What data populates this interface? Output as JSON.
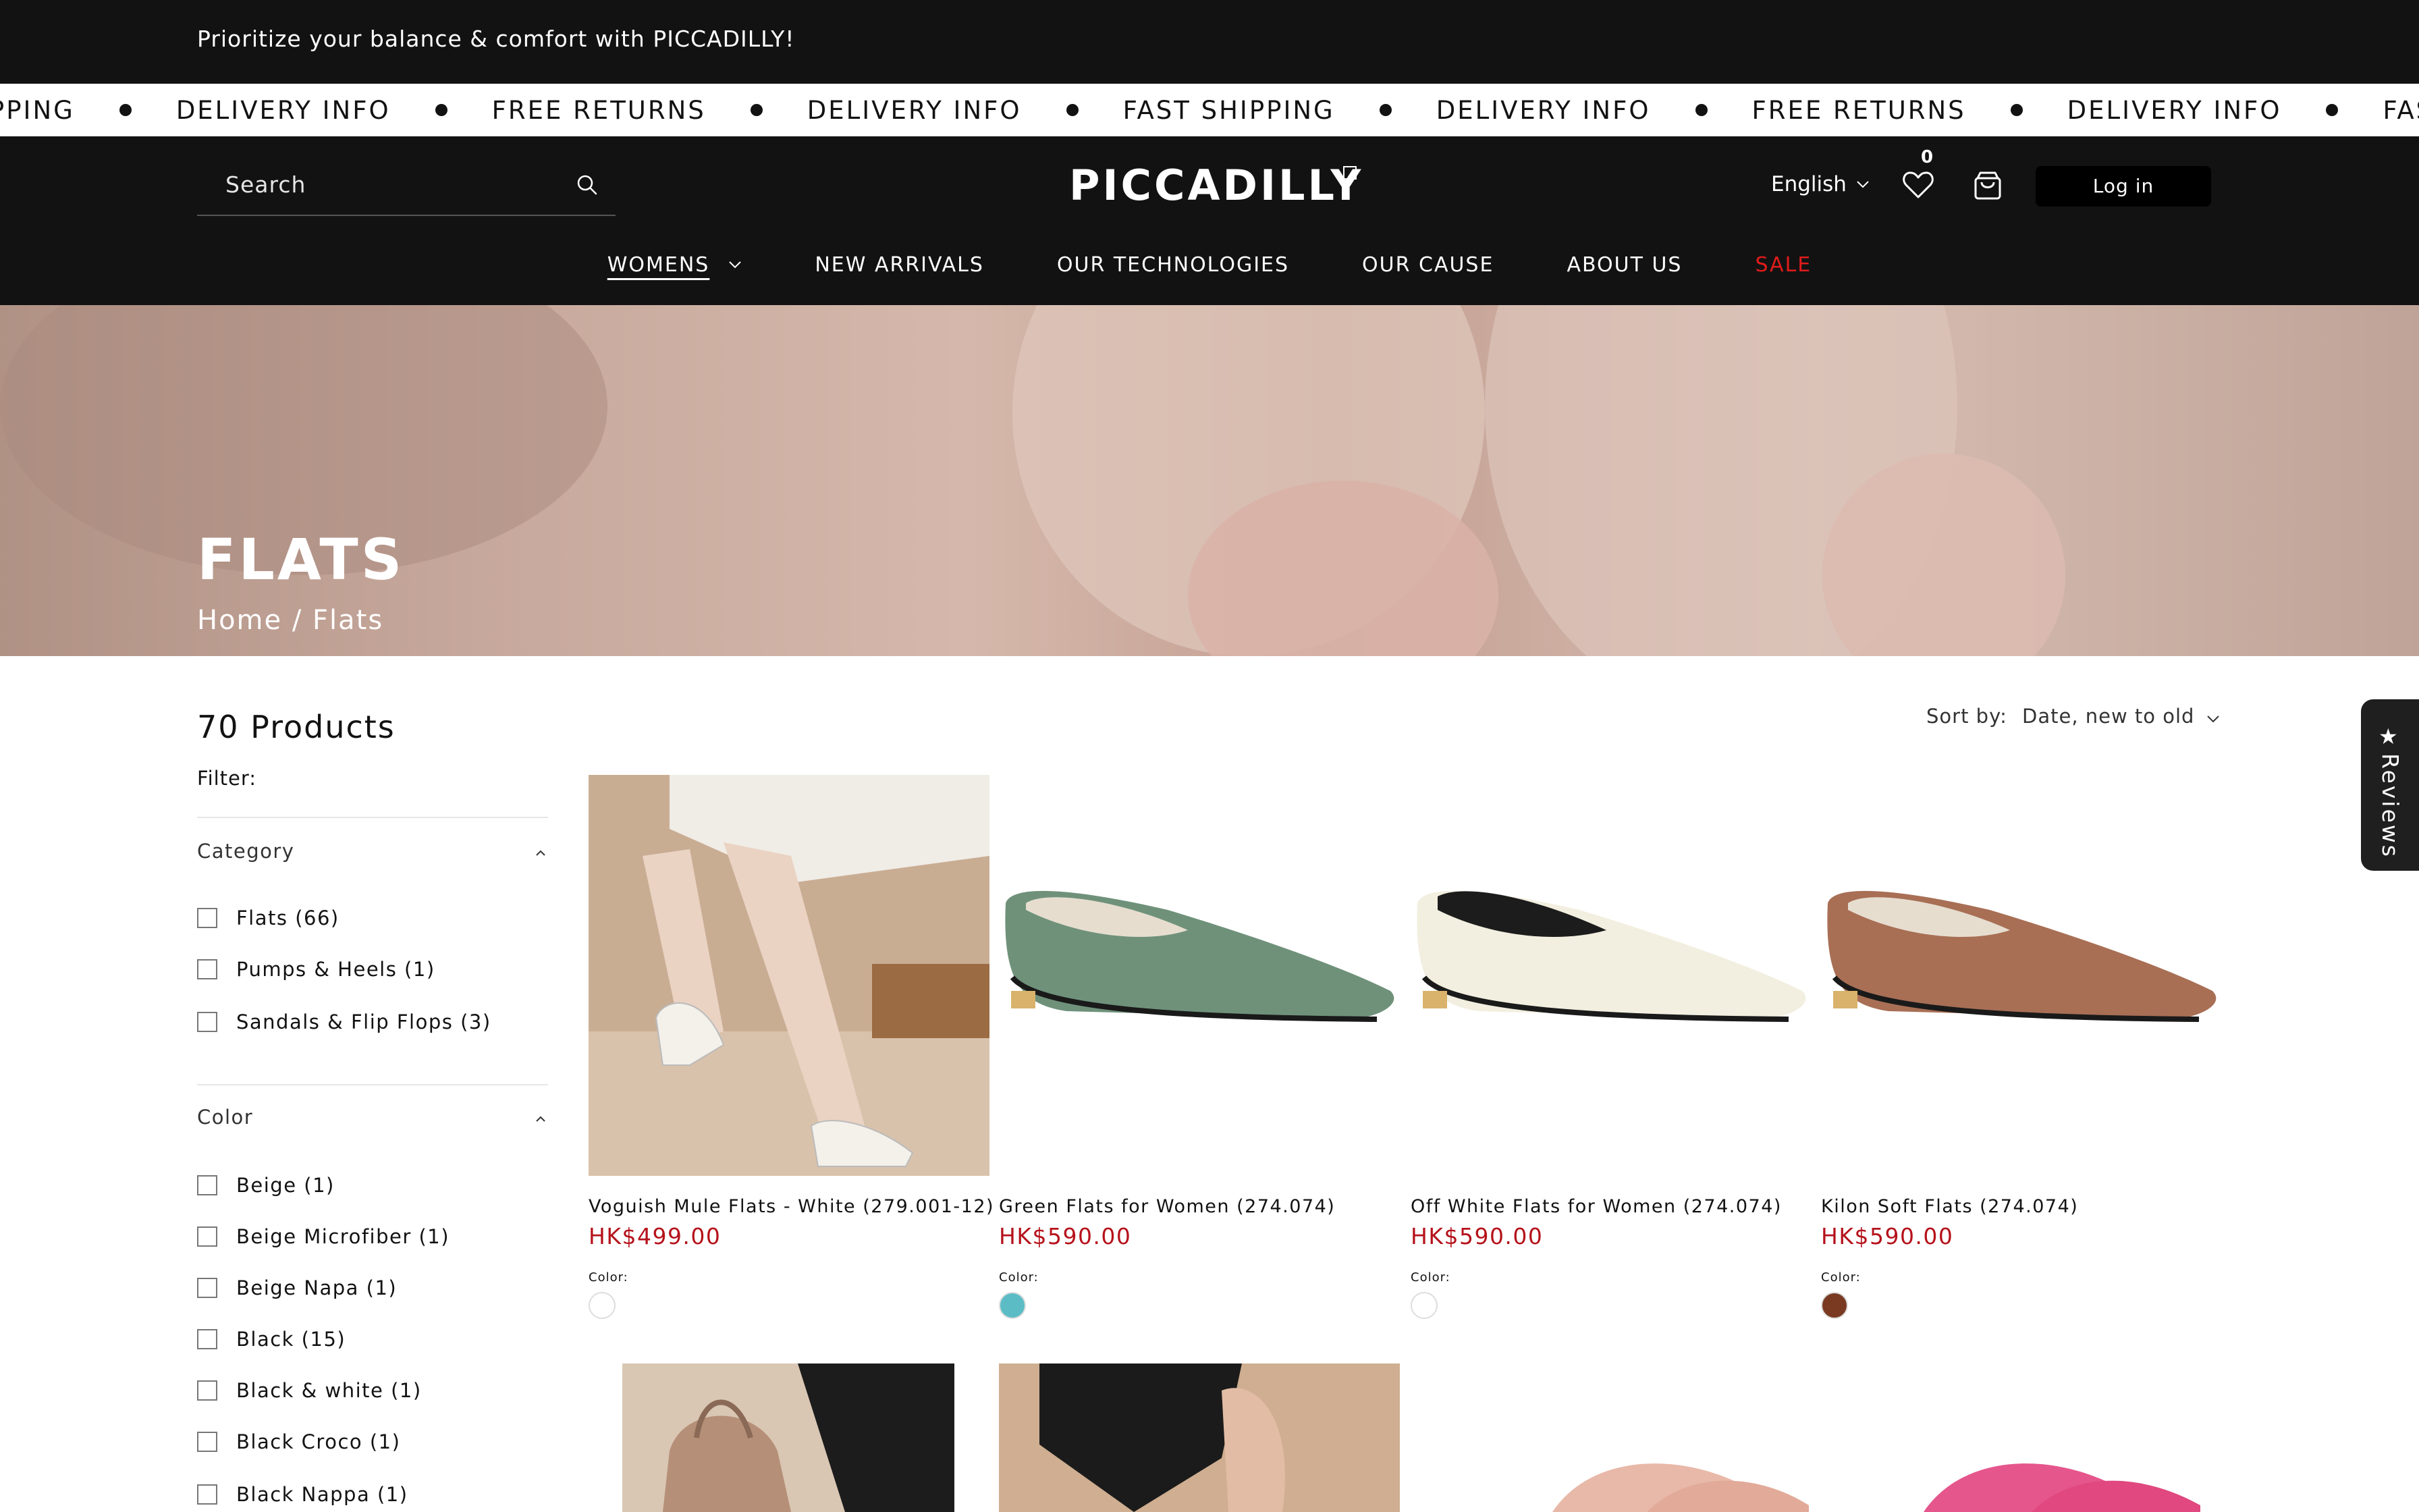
{
  "announcement": {
    "text": "Prioritize your balance & comfort with PICCADILLY!"
  },
  "marquee": {
    "items": [
      "IPPING",
      "DELIVERY INFO",
      "FREE RETURNS",
      "DELIVERY INFO",
      "FAST SHIPPING",
      "DELIVERY INFO",
      "FREE RETURNS",
      "DELIVERY INFO",
      "FAST SHIPPING"
    ]
  },
  "header": {
    "search_placeholder": "Search",
    "logo": "PICCADILLY",
    "language": "English",
    "wishlist_count": "0",
    "login_label": "Log in"
  },
  "nav": {
    "items": [
      {
        "label": "WOMENS"
      },
      {
        "label": "NEW ARRIVALS"
      },
      {
        "label": "OUR TECHNOLOGIES"
      },
      {
        "label": "OUR CAUSE"
      },
      {
        "label": "ABOUT US"
      },
      {
        "label": "SALE"
      }
    ]
  },
  "banner": {
    "title": "FLATS",
    "breadcrumb": "Home / Flats"
  },
  "listing": {
    "product_count": "70 Products",
    "filter_label": "Filter:",
    "sort_label": "Sort by:",
    "sort_value": "Date, new to old"
  },
  "filters": {
    "category": {
      "title": "Category",
      "options": [
        "Flats (66)",
        "Pumps & Heels (1)",
        "Sandals & Flip Flops (3)"
      ]
    },
    "color": {
      "title": "Color",
      "options": [
        "Beige (1)",
        "Beige Microfiber (1)",
        "Beige Napa (1)",
        "Black (15)",
        "Black & white (1)",
        "Black Croco (1)",
        "Black Nappa (1)"
      ]
    }
  },
  "products": [
    {
      "title": "Voguish Mule Flats - White (279.001-12)",
      "price": "HK$499.00",
      "color_label": "Color:",
      "swatch": "#ffffff"
    },
    {
      "title": "Green Flats for Women (274.074)",
      "price": "HK$590.00",
      "color_label": "Color:",
      "swatch": "#5bbcc6"
    },
    {
      "title": "Off White Flats for Women (274.074)",
      "price": "HK$590.00",
      "color_label": "Color:",
      "swatch": "#ffffff"
    },
    {
      "title": "Kilon Soft Flats (274.074)",
      "price": "HK$590.00",
      "color_label": "Color:",
      "swatch": "#7a3a22"
    }
  ],
  "reviews_tab": {
    "label": "Reviews"
  },
  "colors": {
    "header_bg": "#121212",
    "sale": "#e21b1b",
    "price": "#b5121b"
  }
}
